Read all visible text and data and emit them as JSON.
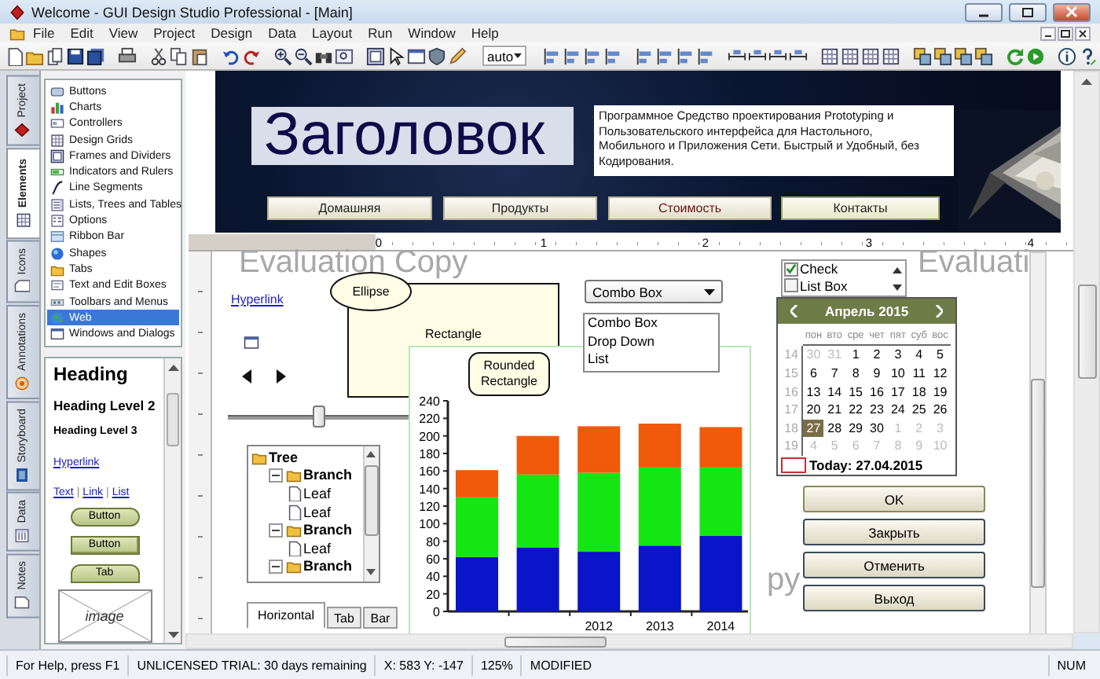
{
  "window": {
    "title": "Welcome - GUI Design Studio Professional - [Main]"
  },
  "menu": [
    "File",
    "Edit",
    "View",
    "Project",
    "Design",
    "Data",
    "Layout",
    "Run",
    "Window",
    "Help"
  ],
  "toolbar": {
    "zoom_mode": "auto"
  },
  "side_tabs": [
    {
      "label": "Project",
      "selected": false
    },
    {
      "label": "Elements",
      "selected": true
    },
    {
      "label": "Icons",
      "selected": false
    },
    {
      "label": "Annotations",
      "selected": false
    },
    {
      "label": "Storyboard",
      "selected": false
    },
    {
      "label": "Data",
      "selected": false
    },
    {
      "label": "Notes",
      "selected": false
    }
  ],
  "categories": [
    {
      "label": "Buttons",
      "selected": false
    },
    {
      "label": "Charts",
      "selected": false
    },
    {
      "label": "Controllers",
      "selected": false
    },
    {
      "label": "Design Grids",
      "selected": false
    },
    {
      "label": "Frames and Dividers",
      "selected": false
    },
    {
      "label": "Indicators and Rulers",
      "selected": false
    },
    {
      "label": "Line Segments",
      "selected": false
    },
    {
      "label": "Lists, Trees and Tables",
      "selected": false
    },
    {
      "label": "Options",
      "selected": false
    },
    {
      "label": "Ribbon Bar",
      "selected": false
    },
    {
      "label": "Shapes",
      "selected": false
    },
    {
      "label": "Tabs",
      "selected": false
    },
    {
      "label": "Text and Edit Boxes",
      "selected": false
    },
    {
      "label": "Toolbars and Menus",
      "selected": false
    },
    {
      "label": "Web",
      "selected": true
    },
    {
      "label": "Windows and Dialogs",
      "selected": false
    }
  ],
  "palette": {
    "heading": "Heading",
    "heading2": "Heading Level 2",
    "heading3": "Heading Level 3",
    "hyperlink": "Hyperlink",
    "links": [
      {
        "label": "Text",
        "kind": "link"
      },
      {
        "label": "|",
        "kind": "separator"
      },
      {
        "label": "Link",
        "kind": "link"
      },
      {
        "label": "|",
        "kind": "separator"
      },
      {
        "label": "List",
        "kind": "link"
      }
    ],
    "buttons": [
      {
        "label": "Button",
        "kind": "rounded"
      },
      {
        "label": "Button",
        "kind": "square"
      },
      {
        "label": "Tab",
        "kind": "tab"
      }
    ],
    "image": "image"
  },
  "banner": {
    "heading": "Заголовок",
    "text": "Программное Средство проектирования Prototyping и Пользовательского интерфейса для Настольного, Мобильного и Приложения Сети. Быстрый и Удобный, без Кодирования.",
    "nav": [
      {
        "label": "Домашняя",
        "hover": false,
        "selected": false
      },
      {
        "label": "Продукты",
        "hover": false,
        "selected": false
      },
      {
        "label": "Стоимость",
        "hover": true,
        "selected": false
      },
      {
        "label": "Контакты",
        "hover": false,
        "selected": true
      }
    ]
  },
  "ruler": [
    "0",
    "1",
    "2",
    "3",
    "4"
  ],
  "watermarks": [
    "Evaluation Copy",
    "Evaluati",
    "py"
  ],
  "canvas": {
    "hyperlink": "Hyperlink",
    "ellipse": "Ellipse",
    "rectangle": "Rectangle",
    "rounded_rectangle": "Rounded Rectangle",
    "slider": {
      "level": 0.5
    },
    "tree": {
      "label": "Tree",
      "children": [
        {
          "label": "Branch",
          "expanded": true,
          "children": [
            {
              "label": "Leaf"
            },
            {
              "label": "Leaf"
            }
          ]
        },
        {
          "label": "Branch",
          "expanded": true,
          "children": [
            {
              "label": "Leaf"
            }
          ]
        },
        {
          "label": "Branch",
          "expanded": true
        }
      ]
    },
    "tabs": [
      {
        "label": "Horizontal",
        "selected": true
      },
      {
        "label": "Tab",
        "selected": false
      },
      {
        "label": "Bar",
        "selected": false
      }
    ],
    "combo": {
      "value": "Combo Box"
    },
    "list": [
      "Combo Box",
      "Drop Down",
      "List"
    ],
    "checklist": [
      {
        "label": "Check",
        "checked": true
      },
      {
        "label": "List Box",
        "checked": false
      }
    ],
    "chart_data": {
      "type": "bar",
      "stacked": true,
      "categories": [
        null,
        null,
        "2012",
        "2013",
        "2014"
      ],
      "ylim": [
        0,
        240
      ],
      "yticks": [
        0,
        20,
        40,
        60,
        80,
        100,
        120,
        140,
        160,
        180,
        200,
        220,
        240
      ],
      "series": [
        {
          "color": "#0a14c8",
          "values": [
            62,
            73,
            68,
            75,
            86
          ]
        },
        {
          "color": "#14e614",
          "values": [
            68,
            83,
            90,
            89,
            78
          ]
        },
        {
          "color": "#f05a0a",
          "values": [
            31,
            44,
            53,
            50,
            46
          ]
        }
      ]
    },
    "calendar": {
      "title": "Апрель 2015",
      "weekdays": [
        "пон",
        "вто",
        "сре",
        "чет",
        "пят",
        "суб",
        "вос"
      ],
      "weeks": [
        {
          "number": "14",
          "days": [
            {
              "d": "30",
              "outside": true,
              "selected": false
            },
            {
              "d": "31",
              "outside": true,
              "selected": false
            },
            {
              "d": "1",
              "outside": false,
              "selected": false
            },
            {
              "d": "2",
              "outside": false,
              "selected": false
            },
            {
              "d": "3",
              "outside": false,
              "selected": false
            },
            {
              "d": "4",
              "outside": false,
              "selected": false
            },
            {
              "d": "5",
              "outside": false,
              "selected": false
            }
          ]
        },
        {
          "number": "15",
          "days": [
            {
              "d": "6",
              "outside": false,
              "selected": false
            },
            {
              "d": "7",
              "outside": false,
              "selected": false
            },
            {
              "d": "8",
              "outside": false,
              "selected": false
            },
            {
              "d": "9",
              "outside": false,
              "selected": false
            },
            {
              "d": "10",
              "outside": false,
              "selected": false
            },
            {
              "d": "11",
              "outside": false,
              "selected": false
            },
            {
              "d": "12",
              "outside": false,
              "selected": false
            }
          ]
        },
        {
          "number": "16",
          "days": [
            {
              "d": "13",
              "outside": false,
              "selected": false
            },
            {
              "d": "14",
              "outside": false,
              "selected": false
            },
            {
              "d": "15",
              "outside": false,
              "selected": false
            },
            {
              "d": "16",
              "outside": false,
              "selected": false
            },
            {
              "d": "17",
              "outside": false,
              "selected": false
            },
            {
              "d": "18",
              "outside": false,
              "selected": false
            },
            {
              "d": "19",
              "outside": false,
              "selected": false
            }
          ]
        },
        {
          "number": "17",
          "days": [
            {
              "d": "20",
              "outside": false,
              "selected": false
            },
            {
              "d": "21",
              "outside": false,
              "selected": false
            },
            {
              "d": "22",
              "outside": false,
              "selected": false
            },
            {
              "d": "23",
              "outside": false,
              "selected": false
            },
            {
              "d": "24",
              "outside": false,
              "selected": false
            },
            {
              "d": "25",
              "outside": false,
              "selected": false
            },
            {
              "d": "26",
              "outside": false,
              "selected": false
            }
          ]
        },
        {
          "number": "18",
          "days": [
            {
              "d": "27",
              "outside": false,
              "selected": true
            },
            {
              "d": "28",
              "outside": false,
              "selected": false
            },
            {
              "d": "29",
              "outside": false,
              "selected": false
            },
            {
              "d": "30",
              "outside": false,
              "selected": false
            },
            {
              "d": "1",
              "outside": true,
              "selected": false
            },
            {
              "d": "2",
              "outside": true,
              "selected": false
            },
            {
              "d": "3",
              "outside": true,
              "selected": false
            }
          ]
        },
        {
          "number": "19",
          "days": [
            {
              "d": "4",
              "outside": true,
              "selected": false
            },
            {
              "d": "5",
              "outside": true,
              "selected": false
            },
            {
              "d": "6",
              "outside": true,
              "selected": false
            },
            {
              "d": "7",
              "outside": true,
              "selected": false
            },
            {
              "d": "8",
              "outside": true,
              "selected": false
            },
            {
              "d": "9",
              "outside": true,
              "selected": false
            },
            {
              "d": "10",
              "outside": true,
              "selected": false
            }
          ]
        }
      ],
      "today": "Today: 27.04.2015"
    },
    "buttons": [
      {
        "label": "OK",
        "default": true
      },
      {
        "label": "Закрыть",
        "default": false
      },
      {
        "label": "Отменить",
        "default": false
      },
      {
        "label": "Выход",
        "default": false
      }
    ]
  },
  "status_bar": [
    "For Help, press F1",
    "UNLICENSED TRIAL: 30 days remaining",
    "X: 583  Y: -147",
    "125%",
    "MODIFIED",
    "NUM"
  ]
}
